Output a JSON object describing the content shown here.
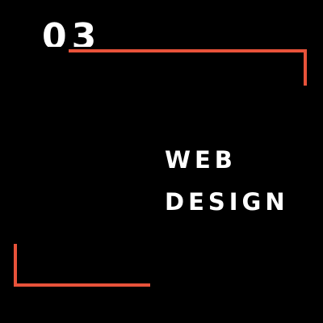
{
  "section": {
    "number": "03"
  },
  "title": {
    "line1": "WEB",
    "line2": "DESIGN"
  },
  "colors": {
    "background": "#000000",
    "text": "#ffffff",
    "accent": "#e8523a"
  }
}
